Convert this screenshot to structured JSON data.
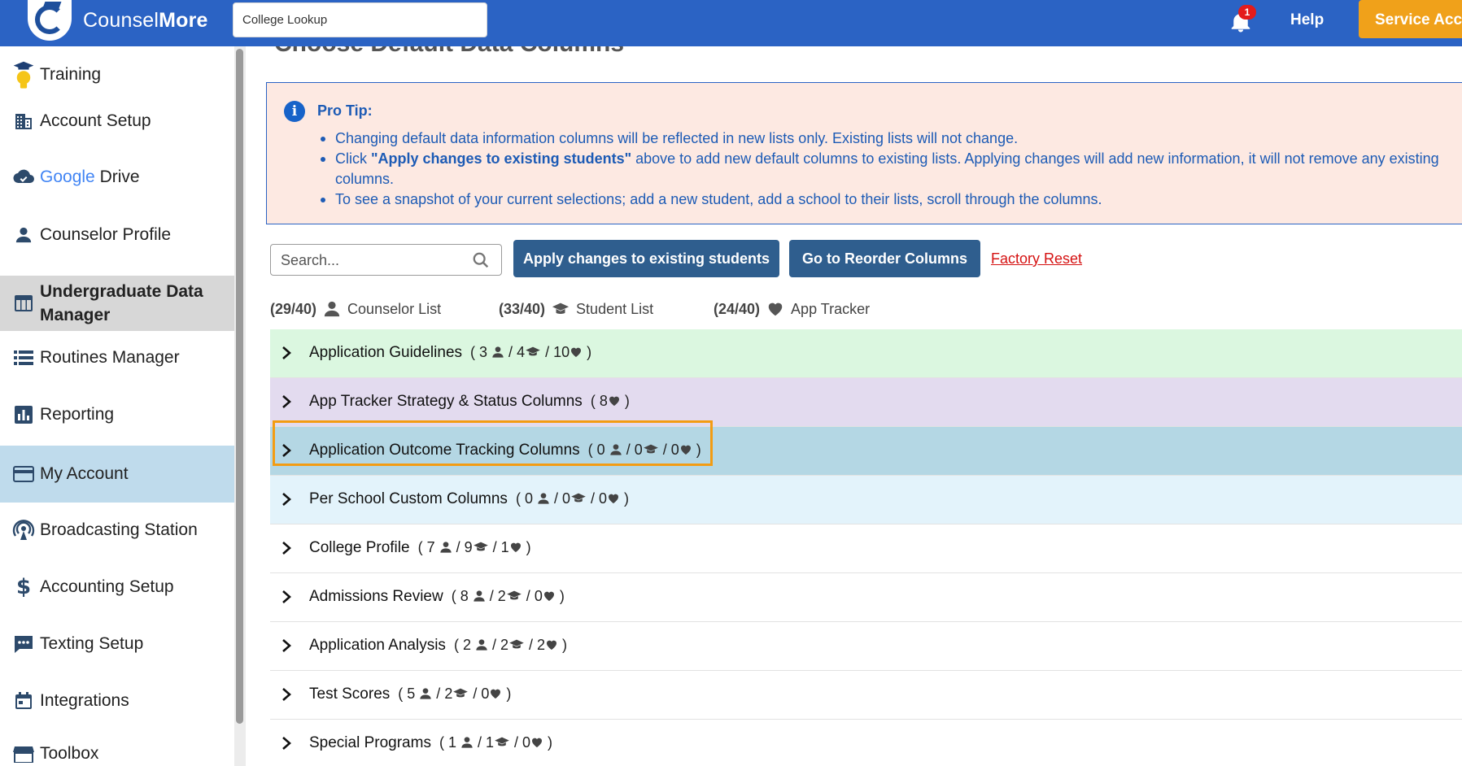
{
  "app": {
    "brand_part1": "Counsel",
    "brand_part2": "More",
    "lookup_value": "College Lookup",
    "notification_count": "1",
    "help_label": "Help",
    "service_label": "Service Account"
  },
  "sidebar": {
    "items": [
      {
        "label": "Training",
        "icon": "graduation-bulb-icon"
      },
      {
        "label": "Account Setup",
        "icon": "building-icon"
      },
      {
        "label": "Drive",
        "icon": "cloud-check-icon"
      },
      {
        "label": "Counselor Profile",
        "icon": "person-icon"
      },
      {
        "label": "Undergraduate Data Manager",
        "icon": "table-icon"
      },
      {
        "label": "Routines Manager",
        "icon": "list-icon"
      },
      {
        "label": "Reporting",
        "icon": "bar-chart-icon"
      },
      {
        "label": "My Account",
        "icon": "credit-card-icon"
      },
      {
        "label": "Broadcasting Station",
        "icon": "broadcast-icon"
      },
      {
        "label": "Accounting Setup",
        "icon": "dollar-icon"
      },
      {
        "label": "Texting Setup",
        "icon": "chat-icon"
      },
      {
        "label": "Integrations",
        "icon": "calendar-icon"
      },
      {
        "label": "Toolbox",
        "icon": "store-icon"
      }
    ],
    "google_word": "Google"
  },
  "main": {
    "page_title": "Choose Default Data Columns",
    "protip": {
      "title": "Pro Tip:",
      "bullets": [
        "Changing default data information columns will be reflected in new lists only. Existing lists will not change.",
        "above to add new default columns to existing lists. Applying changes will add new information, it will not remove any existing columns.",
        "To see a snapshot of your current selections; add a new student, add a school to their lists, scroll through the columns."
      ],
      "bullet2_prefix": "Click ",
      "bullet2_bold": "\"Apply changes to existing students\""
    },
    "search_placeholder": "Search...",
    "apply_label": "Apply changes to existing students",
    "reorder_label": "Go to Reorder Columns",
    "factory_label": "Factory Reset",
    "counts": [
      {
        "num": "(29/40)",
        "label": "Counselor List"
      },
      {
        "num": "(33/40)",
        "label": "Student List"
      },
      {
        "num": "(24/40)",
        "label": "App Tracker"
      }
    ],
    "rows": [
      {
        "title": "Application Guidelines",
        "p": "3",
        "s": "4",
        "h": "10"
      },
      {
        "title": "App Tracker Strategy & Status Columns",
        "h": "8"
      },
      {
        "title": "Application Outcome Tracking Columns",
        "p": "0",
        "s": "0",
        "h": "0"
      },
      {
        "title": "Per School Custom Columns",
        "p": "0",
        "s": "0",
        "h": "0"
      },
      {
        "title": "College Profile",
        "p": "7",
        "s": "9",
        "h": "1"
      },
      {
        "title": "Admissions Review",
        "p": "8",
        "s": "2",
        "h": "0"
      },
      {
        "title": "Application Analysis",
        "p": "2",
        "s": "2",
        "h": "2"
      },
      {
        "title": "Test Scores",
        "p": "5",
        "s": "2",
        "h": "0"
      },
      {
        "title": "Special Programs",
        "p": "1",
        "s": "1",
        "h": "0"
      }
    ]
  },
  "colors": {
    "topbar": "#2b63c4",
    "accent_orange": "#f0a11a",
    "button": "#2f5e8e",
    "protip_bg": "#fde9e2",
    "focus_outline": "#f39c12"
  }
}
